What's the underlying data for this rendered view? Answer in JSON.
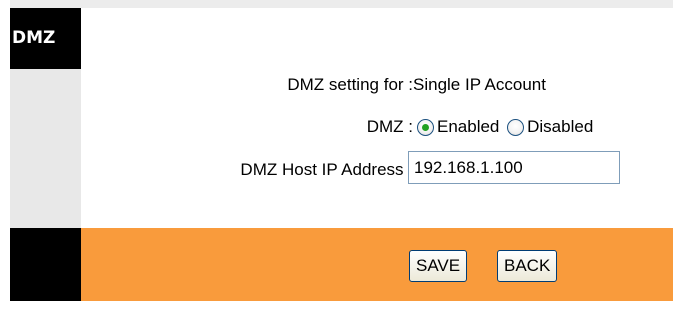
{
  "section": {
    "title": "DMZ"
  },
  "form": {
    "setting_label": "DMZ setting for :",
    "setting_value": "Single IP Account",
    "dmz_label": "DMZ :",
    "dmz_options": [
      {
        "label": "Enabled",
        "selected": true
      },
      {
        "label": "Disabled",
        "selected": false
      }
    ],
    "host_ip_label": "DMZ Host IP Address :",
    "host_ip_value": "192.168.1.100"
  },
  "buttons": {
    "save_label": "SAVE",
    "back_label": "BACK"
  },
  "colors": {
    "accent_bar": "#f99b3c",
    "section_label_bg": "#000000",
    "side_column": "#e8e8e8",
    "radio_dot": "#21a121"
  }
}
